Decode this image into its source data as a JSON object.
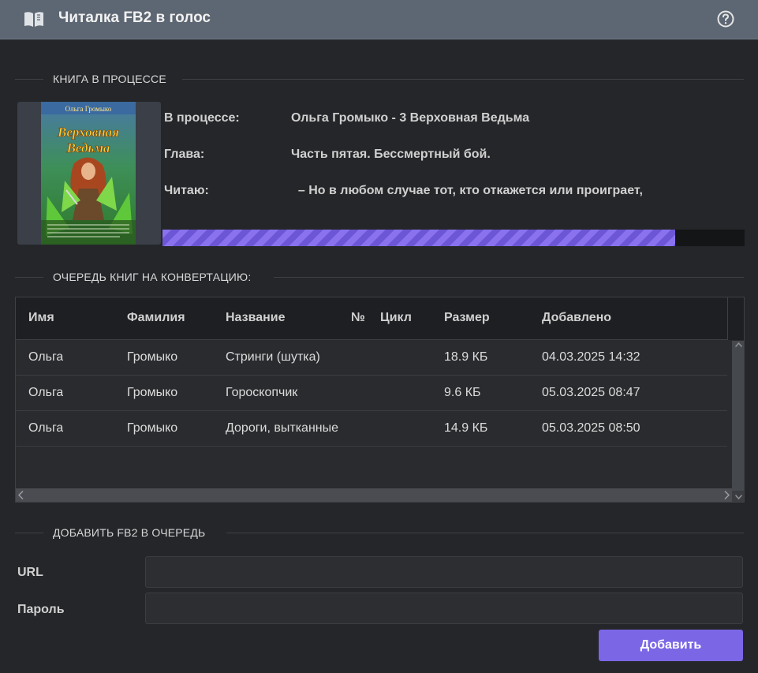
{
  "app": {
    "title": "Читалка FB2 в голос",
    "icons": {
      "app": "book-open-icon",
      "help": "help-circle-icon"
    }
  },
  "current_book": {
    "section_title": "КНИГА В ПРОЦЕССЕ",
    "cover": {
      "author": "Ольга Громыко",
      "title_line1": "Верховная",
      "title_line2": "Ведьма"
    },
    "in_progress_label": "В процессе:",
    "in_progress_value": "Ольга Громыко - 3 Верховная Ведьма",
    "chapter_label": "Глава:",
    "chapter_value": "Часть пятая. Бессмертный бой.",
    "reading_label": "Читаю:",
    "reading_value": "  – Но в любом случае тот, кто откажется или проиграет,",
    "progress_fraction": 0.881,
    "progress_color": "#8a72ee"
  },
  "queue": {
    "section_title": "ОЧЕРЕДЬ КНИГ НА КОНВЕРТАЦИЮ:",
    "columns": [
      "Имя",
      "Фамилия",
      "Название",
      "№",
      "Цикл",
      "Размер",
      "Добавлено"
    ],
    "rows": [
      [
        "Ольга",
        "Громыко",
        "Стринги (шутка)",
        "",
        "",
        "18.9 КБ",
        "04.03.2025 14:32"
      ],
      [
        "Ольга",
        "Громыко",
        "Гороскопчик",
        "",
        "",
        "9.6 КБ",
        "05.03.2025 08:47"
      ],
      [
        "Ольга",
        "Громыко",
        "Дороги, вытканные",
        "",
        "",
        "14.9 КБ",
        "05.03.2025 08:50"
      ]
    ]
  },
  "add_form": {
    "section_title": "ДОБАВИТЬ FB2 В ОЧЕРЕДЬ",
    "url_label": "URL",
    "url_value": "",
    "password_label": "Пароль",
    "password_value": "",
    "submit_label": "Добавить",
    "accent": "#7b66e6"
  }
}
